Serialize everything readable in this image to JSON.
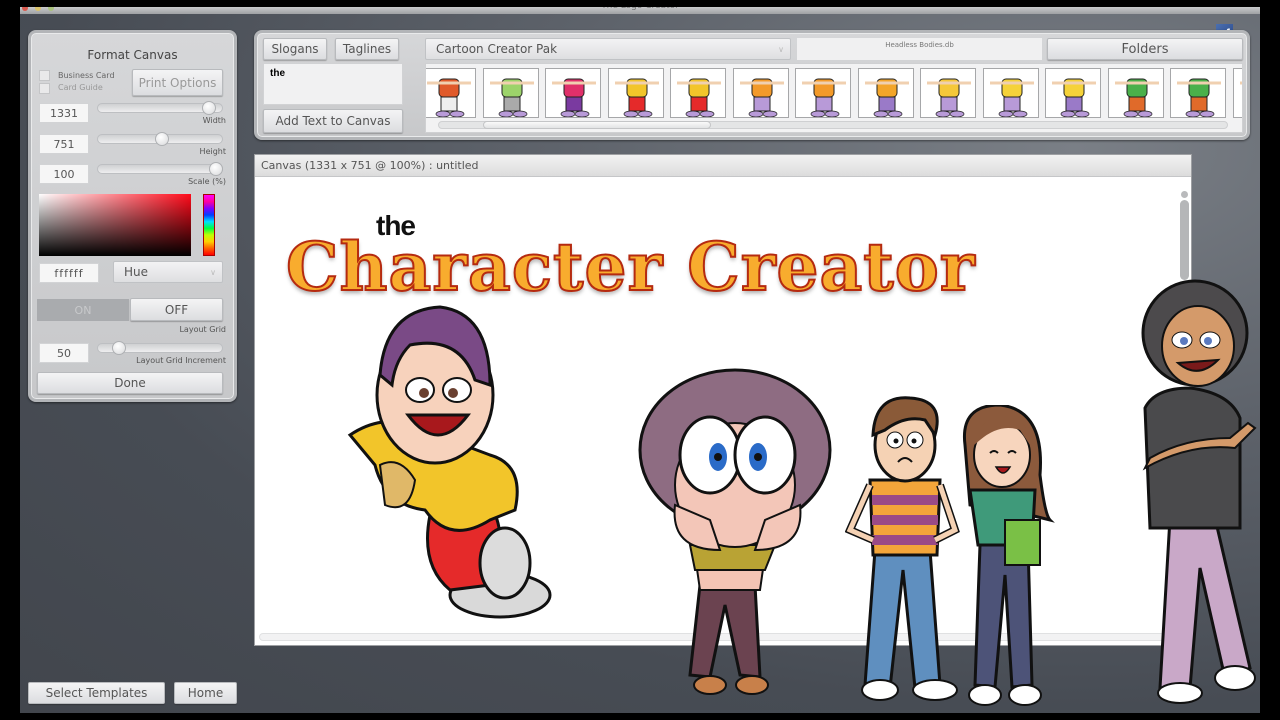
{
  "window": {
    "title": "The Logo Creator",
    "traffic_lights": [
      "close",
      "minimize",
      "zoom"
    ]
  },
  "format_canvas": {
    "heading": "Format Canvas",
    "business_card_label": "Business Card",
    "card_guide_label": "Card Guide",
    "print_options_label": "Print Options",
    "width": {
      "value": "1331",
      "label": "Width",
      "slider_fraction": 0.92
    },
    "height": {
      "value": "751",
      "label": "Height",
      "slider_fraction": 0.52
    },
    "scale": {
      "value": "100",
      "label": "Scale (%)",
      "slider_fraction": 1.0
    },
    "color_hex": "ffffff",
    "color_mode": "Hue",
    "layout_grid": {
      "on_label": "ON",
      "off_label": "OFF",
      "selected": "OFF",
      "label": "Layout Grid"
    },
    "grid_increment": {
      "value": "50",
      "label": "Layout Grid Increment",
      "slider_fraction": 0.12
    },
    "done_label": "Done"
  },
  "text_panel": {
    "slogans_label": "Slogans",
    "taglines_label": "Taglines",
    "text_value": "the",
    "add_text_label": "Add Text to Canvas"
  },
  "library": {
    "pack_select": "Cartoon Creator Pak",
    "database_name": "Headless Bodies.db",
    "folders_label": "Folders",
    "thumbnails": [
      "orange-shirt-body",
      "green-shirt-body",
      "pink-jacket-body",
      "yellow-shirt-red-pants-leaning",
      "yellow-shirt-red-pants-bending",
      "orange-dress-pointing",
      "orange-dress-crossed",
      "orange-dress-sitting",
      "yellow-dress-waving",
      "yellow-dress-stretching",
      "yellow-dress-kicking",
      "green-shirt-holding-sign",
      "green-shirt-orange-pants",
      "green-shirt-partial"
    ]
  },
  "canvas": {
    "header": "Canvas (1331 x 751 @ 100%) : untitled",
    "title_small": "the",
    "title_large": "Character Creator"
  },
  "footer": {
    "select_templates_label": "Select Templates",
    "home_label": "Home"
  },
  "social": {
    "facebook_icon": "f"
  },
  "colors": {
    "title_fill": "#f8ac2e",
    "title_outline": "#b52a10",
    "window_bg": "#474c54",
    "panel_bg": "#d0d1d3"
  }
}
